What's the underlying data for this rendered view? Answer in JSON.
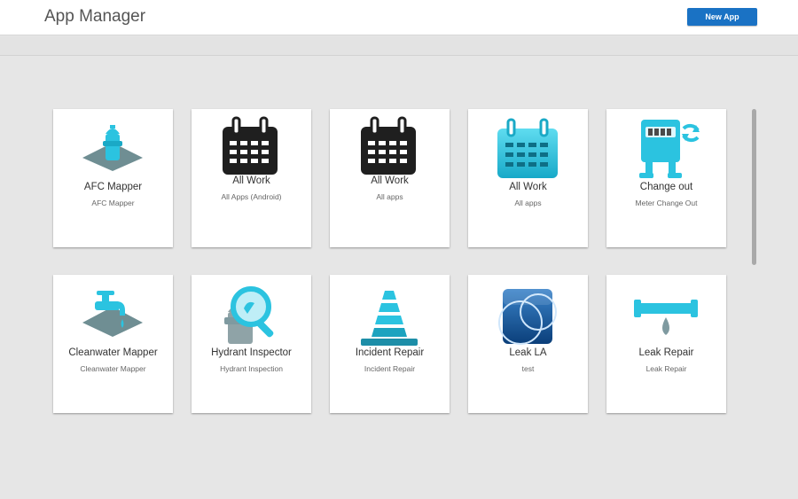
{
  "header": {
    "title": "App Manager",
    "new_app_label": "New App"
  },
  "colors": {
    "accent": "#1a72c4",
    "icon_cyan": "#2bc3e0",
    "icon_dark": "#1f1f1f",
    "icon_gray": "#7f9aa0"
  },
  "apps": [
    {
      "title": "AFC Mapper",
      "subtitle": "AFC Mapper",
      "icon": "hydrant-map-icon"
    },
    {
      "title": "All Work",
      "subtitle": "All Apps (Android)",
      "icon": "calendar-black-icon"
    },
    {
      "title": "All Work",
      "subtitle": "All apps",
      "icon": "calendar-black-icon"
    },
    {
      "title": "All Work",
      "subtitle": "All apps",
      "icon": "calendar-cyan-icon"
    },
    {
      "title": "Change out",
      "subtitle": "Meter Change Out",
      "icon": "meter-change-icon"
    },
    {
      "title": "Cleanwater Mapper",
      "subtitle": "Cleanwater Mapper",
      "icon": "faucet-map-icon"
    },
    {
      "title": "Hydrant Inspector",
      "subtitle": "Hydrant Inspection",
      "icon": "hydrant-magnifier-icon"
    },
    {
      "title": "Incident Repair",
      "subtitle": "Incident Repair",
      "icon": "traffic-cone-icon"
    },
    {
      "title": "Leak LA",
      "subtitle": "test",
      "icon": "blue-globe-icon"
    },
    {
      "title": "Leak Repair",
      "subtitle": "Leak Repair",
      "icon": "pipe-drip-icon"
    }
  ]
}
